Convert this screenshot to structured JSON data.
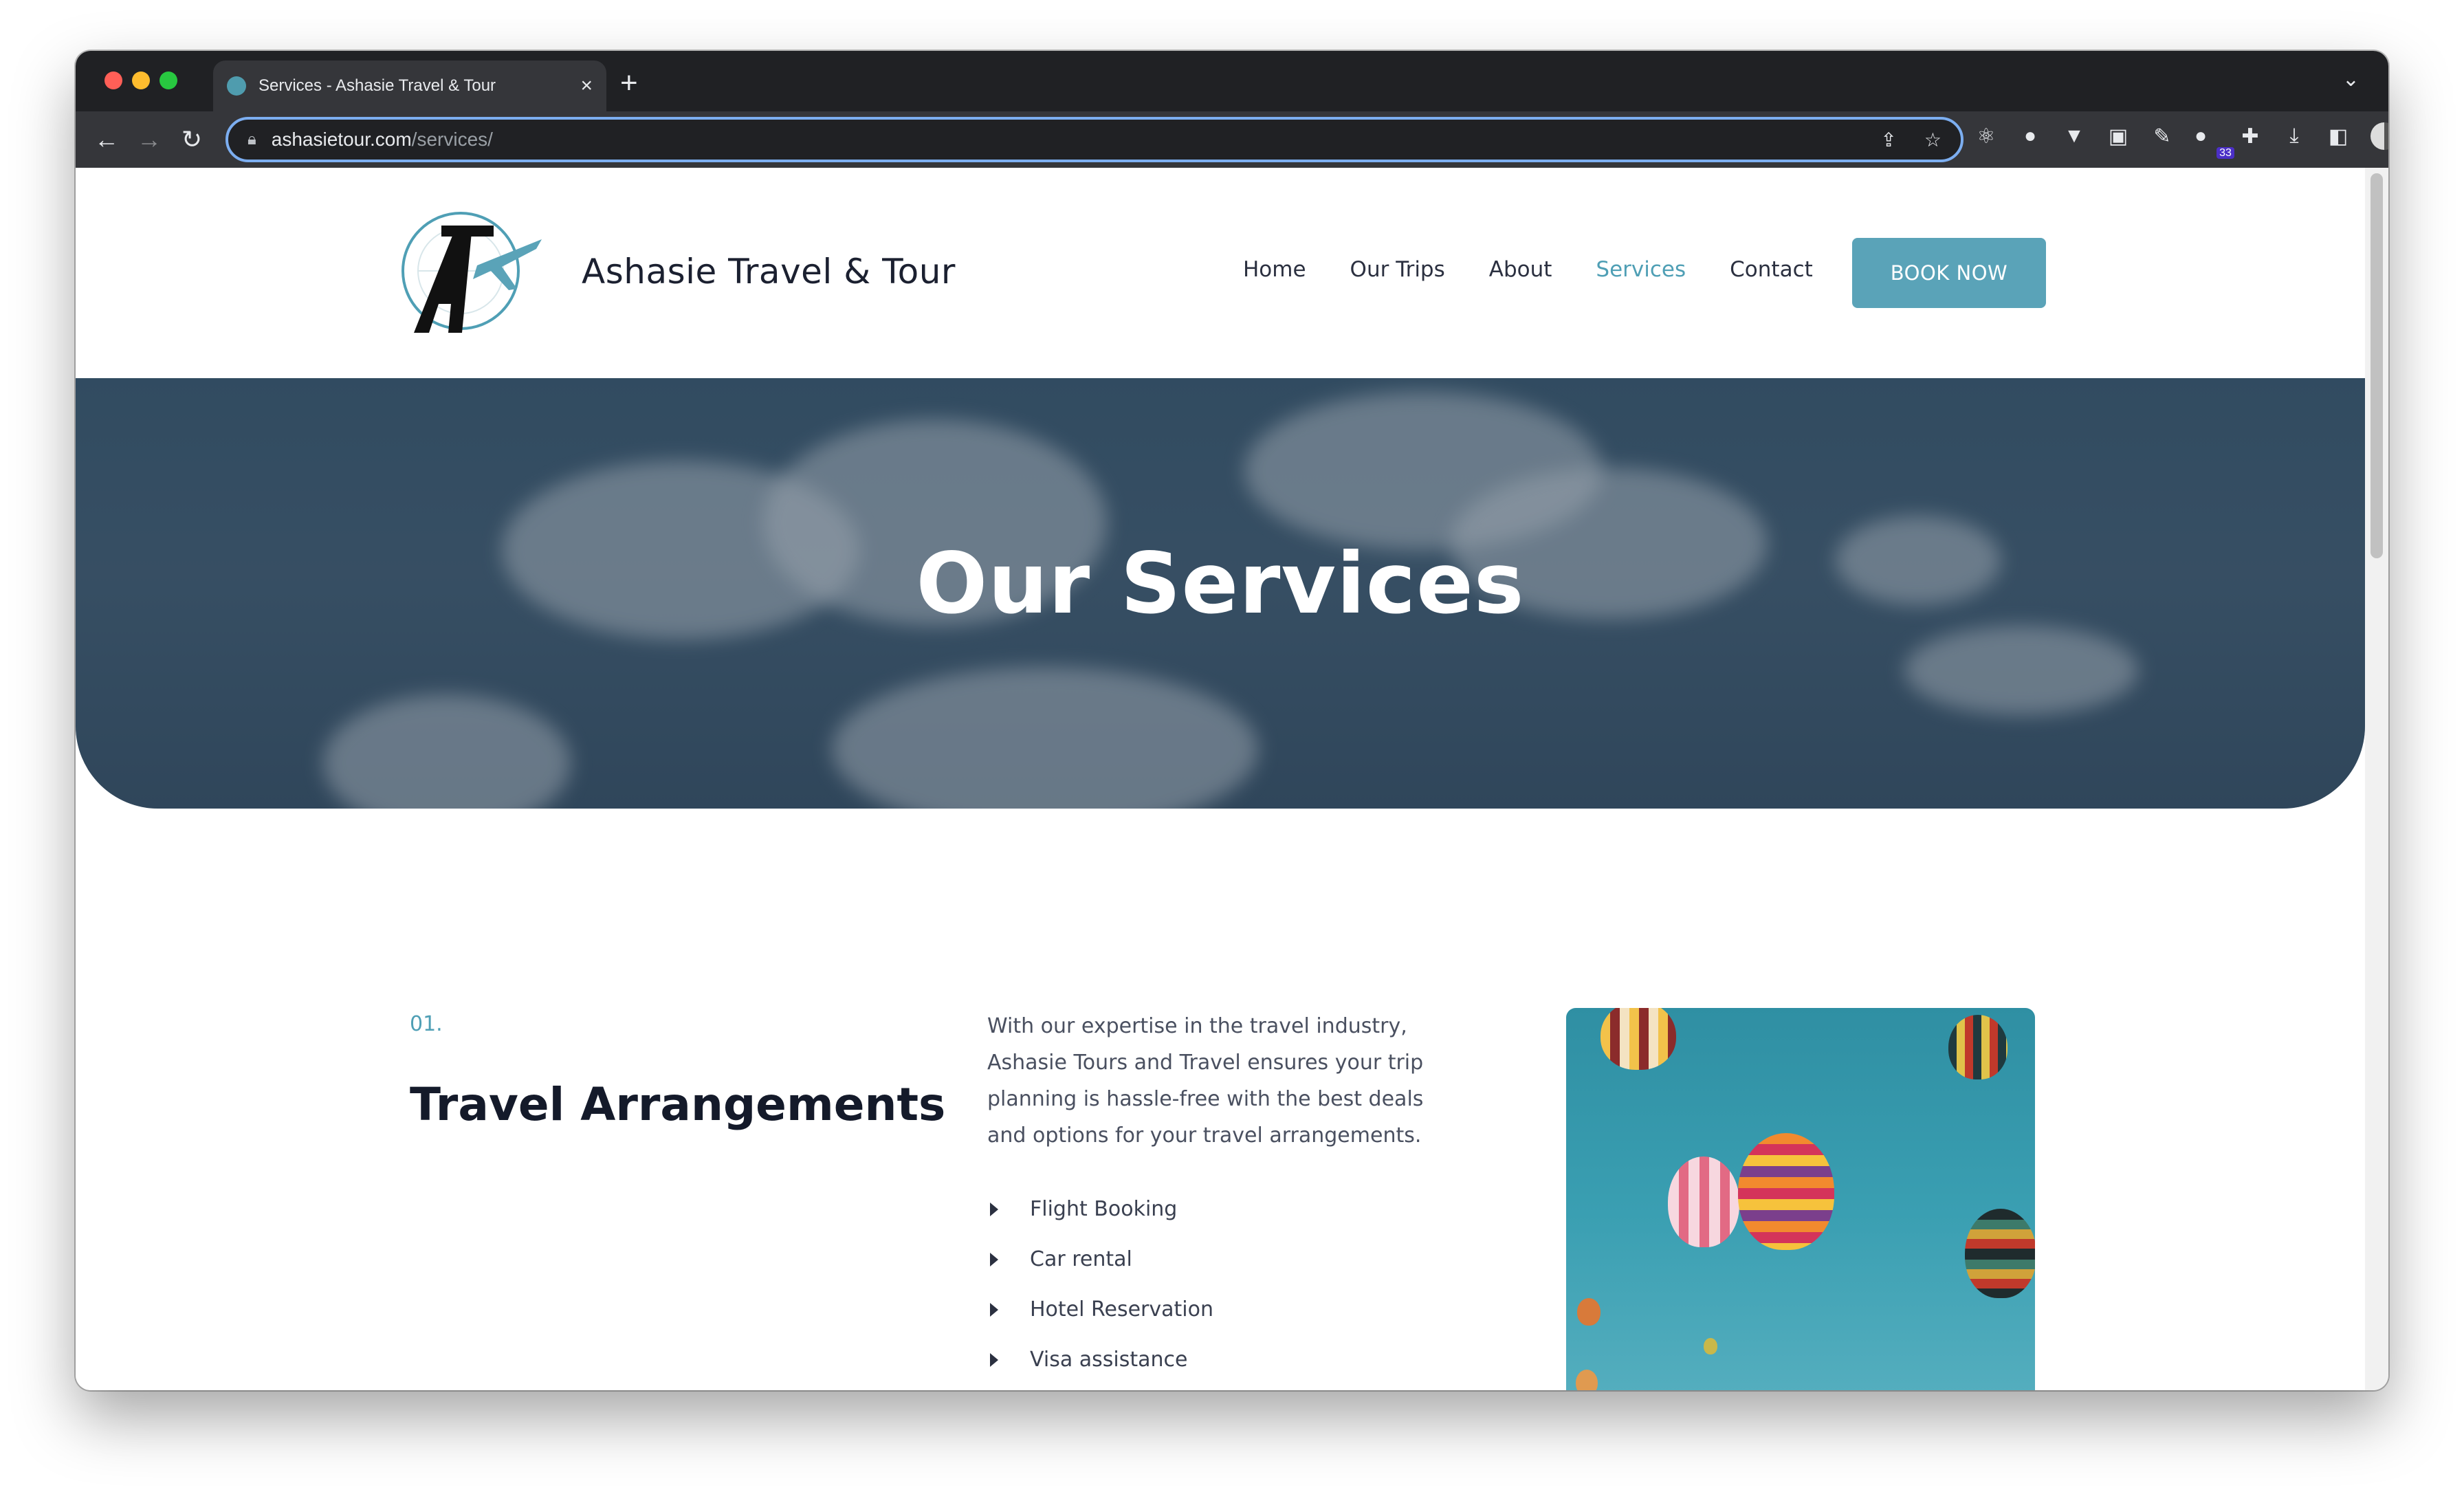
{
  "browser": {
    "tab_title": "Services - Ashasie Travel & Tour",
    "url_host": "ashasietour.com",
    "url_path": "/services/",
    "extension_badge": "33"
  },
  "site": {
    "brand": "Ashasie Travel & Tour",
    "nav": [
      "Home",
      "Our Trips",
      "About",
      "Services",
      "Contact"
    ],
    "active_nav": "Services",
    "book_button": "BOOK NOW"
  },
  "hero": {
    "title": "Our Services"
  },
  "service": {
    "number": "01.",
    "title": "Travel Arrangements",
    "description": "With our expertise in the travel industry, Ashasie Tours and Travel ensures your trip planning is hassle-free with the best deals and options for your travel arrangements.",
    "items": [
      "Flight Booking",
      "Car rental",
      "Hotel Reservation",
      "Visa assistance"
    ]
  },
  "colors": {
    "accent": "#5aa3b8",
    "heading": "#141a2a",
    "hero_bg": "#3d5a70"
  }
}
